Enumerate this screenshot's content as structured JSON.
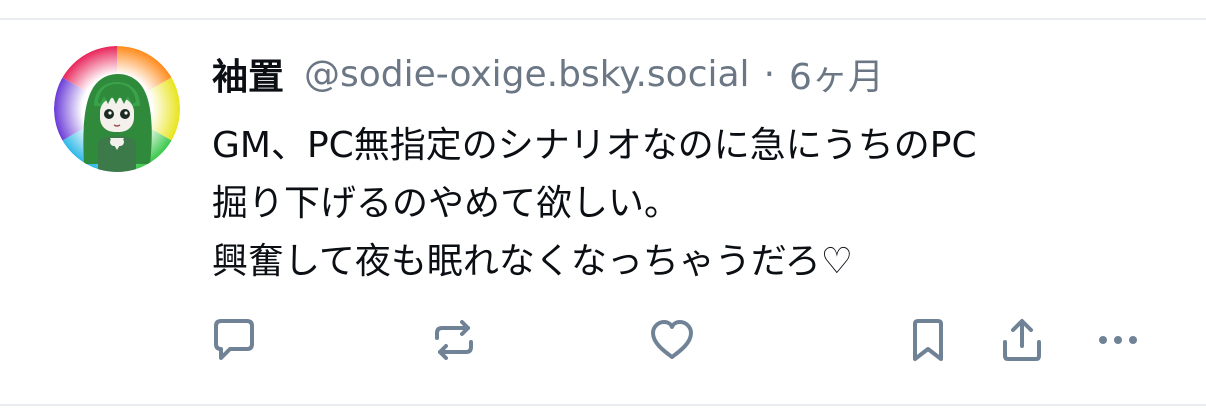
{
  "post": {
    "author": {
      "display_name": "袖置",
      "handle": "@sodie-oxige.bsky.social"
    },
    "separator": "·",
    "timestamp": "6ヶ月",
    "text_lines": [
      "GM、PC無指定のシナリオなのに急にうちのPC",
      "掘り下げるのやめて欲しい。",
      "興奮して夜も眠れなくなっちゃうだろ♡"
    ]
  },
  "actions": [
    {
      "name": "reply",
      "icon": "reply-icon"
    },
    {
      "name": "repost",
      "icon": "repost-icon"
    },
    {
      "name": "like",
      "icon": "heart-icon"
    },
    {
      "name": "bookmark",
      "icon": "bookmark-icon"
    },
    {
      "name": "share",
      "icon": "share-icon"
    },
    {
      "name": "more",
      "icon": "more-icon"
    }
  ],
  "colors": {
    "text": "#0b0f14",
    "muted": "#6b7785",
    "icon": "#6f8296",
    "divider": "#e9edf1",
    "background": "#ffffff"
  }
}
